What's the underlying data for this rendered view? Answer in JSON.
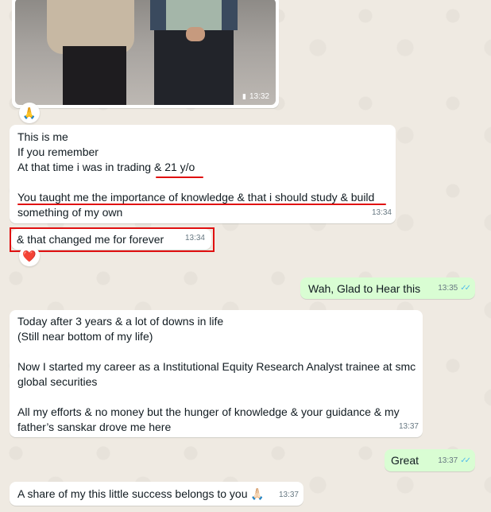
{
  "chat": {
    "photo_message": {
      "time": "13:32",
      "reaction": "🙏"
    },
    "messages": [
      {
        "direction": "incoming",
        "lines": [
          "This is me",
          "If you remember",
          "At that time i was in trading & 21 y/o",
          "",
          "You taught me the importance of knowledge & that i should study & build",
          "something of my own"
        ],
        "time": "13:34"
      },
      {
        "direction": "incoming",
        "lines": [
          "& that changed me for forever"
        ],
        "time": "13:34",
        "reaction": "❤️"
      },
      {
        "direction": "outgoing",
        "lines": [
          "Wah, Glad to Hear this"
        ],
        "time": "13:35",
        "status": "read"
      },
      {
        "direction": "incoming",
        "lines": [
          "Today after 3 years & a lot of downs in life",
          "(Still near bottom of my life)",
          "",
          "Now I started my career as a Institutional Equity Research Analyst trainee at smc",
          "global securities",
          "",
          "All my efforts & no money but the hunger of knowledge & your guidance & my",
          "father’s sanskar drove me here"
        ],
        "time": "13:37"
      },
      {
        "direction": "outgoing",
        "lines": [
          "Great"
        ],
        "time": "13:37",
        "status": "read"
      },
      {
        "direction": "incoming",
        "lines": [
          "A share of my this little success belongs to you 🙏🏻"
        ],
        "time": "13:37"
      }
    ]
  },
  "colors": {
    "background": "#efeae2",
    "incoming_bubble": "#ffffff",
    "outgoing_bubble": "#d9fdd3",
    "annotation_red": "#e01010",
    "read_ticks": "#53bdeb"
  }
}
